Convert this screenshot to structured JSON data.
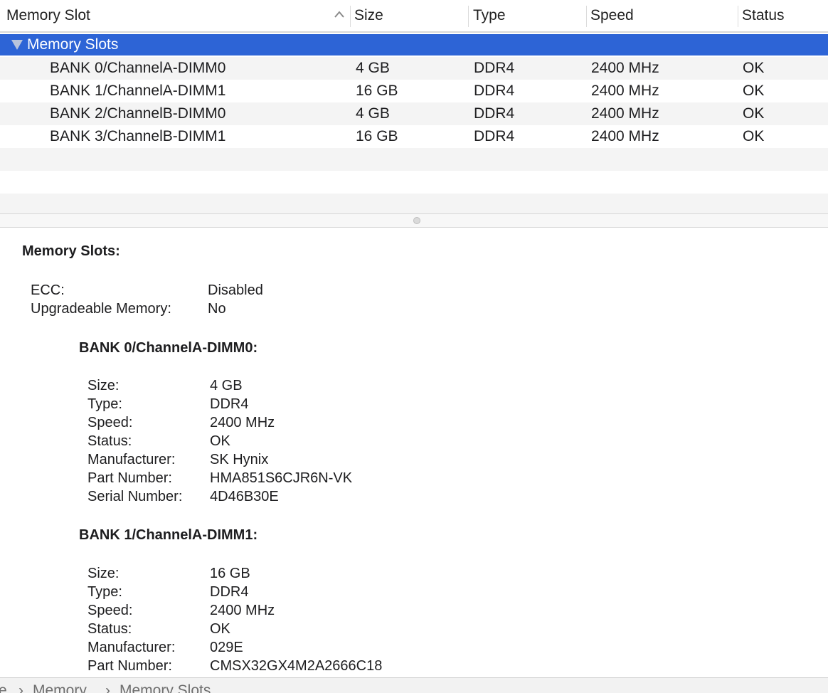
{
  "table": {
    "columns": {
      "slot": "Memory Slot",
      "size": "Size",
      "type": "Type",
      "speed": "Speed",
      "status": "Status"
    },
    "sort_icon": "chevron-up-icon",
    "group": {
      "label": "Memory Slots",
      "icon": "disclosure-triangle-down-icon"
    },
    "rows": [
      {
        "slot": "BANK 0/ChannelA-DIMM0",
        "size": "4 GB",
        "type": "DDR4",
        "speed": "2400 MHz",
        "status": "OK"
      },
      {
        "slot": "BANK 1/ChannelA-DIMM1",
        "size": "16 GB",
        "type": "DDR4",
        "speed": "2400 MHz",
        "status": "OK"
      },
      {
        "slot": "BANK 2/ChannelB-DIMM0",
        "size": "4 GB",
        "type": "DDR4",
        "speed": "2400 MHz",
        "status": "OK"
      },
      {
        "slot": "BANK 3/ChannelB-DIMM1",
        "size": "16 GB",
        "type": "DDR4",
        "speed": "2400 MHz",
        "status": "OK"
      }
    ]
  },
  "detail": {
    "title": "Memory Slots:",
    "summary": [
      {
        "key": "ECC:",
        "value": "Disabled"
      },
      {
        "key": "Upgradeable Memory:",
        "value": "No"
      }
    ],
    "banks": [
      {
        "title": "BANK 0/ChannelA-DIMM0:",
        "fields": [
          {
            "key": "Size:",
            "value": "4 GB"
          },
          {
            "key": "Type:",
            "value": "DDR4"
          },
          {
            "key": "Speed:",
            "value": "2400 MHz"
          },
          {
            "key": "Status:",
            "value": "OK"
          },
          {
            "key": "Manufacturer:",
            "value": "SK Hynix"
          },
          {
            "key": "Part Number:",
            "value": "HMA851S6CJR6N-VK"
          },
          {
            "key": "Serial Number:",
            "value": "4D46B30E"
          }
        ]
      },
      {
        "title": "BANK 1/ChannelA-DIMM1:",
        "fields": [
          {
            "key": "Size:",
            "value": "16 GB"
          },
          {
            "key": "Type:",
            "value": "DDR4"
          },
          {
            "key": "Speed:",
            "value": "2400 MHz"
          },
          {
            "key": "Status:",
            "value": "OK"
          },
          {
            "key": "Manufacturer:",
            "value": "029E"
          },
          {
            "key": "Part Number:",
            "value": "CMSX32GX4M2A2666C18"
          }
        ]
      }
    ]
  },
  "pathbar": {
    "crumbs": [
      "e",
      "Memory",
      "Memory Slots"
    ],
    "separator": "›"
  },
  "colors": {
    "selection": "#2d64d6",
    "row_alt": "#f4f4f4"
  }
}
